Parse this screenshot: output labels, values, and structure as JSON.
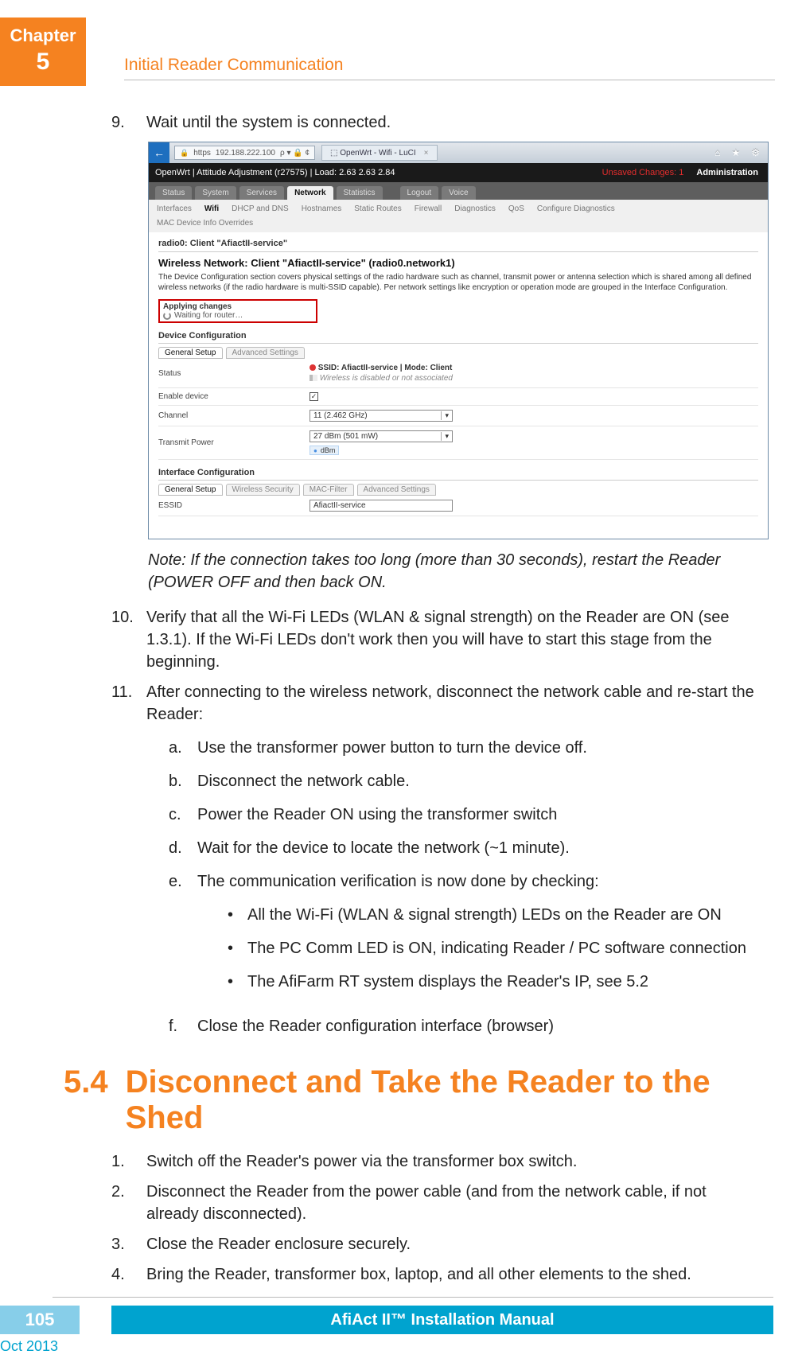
{
  "chapter": {
    "label": "Chapter",
    "number": "5"
  },
  "header_title": "Initial Reader Communication",
  "steps": {
    "s9": {
      "num": "9.",
      "text": "Wait until the system is connected."
    },
    "note": "Note: If the connection takes too long (more than 30 seconds), restart the Reader (POWER OFF and then back ON.",
    "s10": {
      "num": "10.",
      "text": "Verify that all the Wi-Fi LEDs (WLAN & signal strength) on the Reader are ON (see 1.3.1). If the Wi-Fi LEDs don't work then you will have to start this stage from the beginning."
    },
    "s11": {
      "num": "11.",
      "text": "After connecting to the wireless network, disconnect the network cable and re-start the Reader:",
      "sub": {
        "a": {
          "letter": "a.",
          "text": "Use the transformer power button to turn the device off."
        },
        "b": {
          "letter": "b.",
          "text": "Disconnect the network cable."
        },
        "c": {
          "letter": "c.",
          "text": "Power the Reader ON using the transformer switch"
        },
        "d": {
          "letter": "d.",
          "text": "Wait for the device to locate the network (~1 minute)."
        },
        "e": {
          "letter": "e.",
          "text": "The communication verification is now done by checking:",
          "bullets": {
            "b1": "All the Wi-Fi (WLAN & signal strength) LEDs on the Reader are ON",
            "b2": "The PC Comm LED is ON, indicating Reader / PC software connection",
            "b3": "The AfiFarm RT system displays the Reader's IP, see 5.2"
          }
        },
        "f": {
          "letter": "f.",
          "text": "Close the Reader configuration interface (browser)"
        }
      }
    }
  },
  "section54": {
    "num": "5.4",
    "title": "Disconnect and Take the Reader to the Shed",
    "items": {
      "i1": {
        "num": "1.",
        "text": "Switch off the Reader's power via the transformer box switch."
      },
      "i2": {
        "num": "2.",
        "text": "Disconnect the Reader from the power cable (and from the network cable, if not already disconnected)."
      },
      "i3": {
        "num": "3.",
        "text": "Close the Reader enclosure securely."
      },
      "i4": {
        "num": "4.",
        "text": "Bring the Reader, transformer box, laptop, and all other elements to the shed."
      }
    }
  },
  "screenshot": {
    "ie": {
      "url_prefix": "https",
      "url": "192.188.222.100",
      "url_suffix": "ρ ▾ 🔒 ¢",
      "tab": "OpenWrt - Wifi - LuCI",
      "close": "×",
      "home": "⌂",
      "star": "★",
      "gear": "⚙"
    },
    "luci": {
      "title": "OpenWrt | Attitude Adjustment (r27575) | Load: 2.63 2.63 2.84",
      "unsaved": "Unsaved Changes: 1",
      "admin": "Administration"
    },
    "tabs": {
      "status": "Status",
      "system": "System",
      "services": "Services",
      "network": "Network",
      "statistics": "Statistics",
      "logout": "Logout",
      "voice": "Voice"
    },
    "subtabs": {
      "interfaces": "Interfaces",
      "wifi": "Wifi",
      "dhcp": "DHCP and DNS",
      "hostnames": "Hostnames",
      "staticroutes": "Static Routes",
      "firewall": "Firewall",
      "diagnostics": "Diagnostics",
      "qos": "QoS",
      "configdiag": "Configure Diagnostics"
    },
    "macline": "MAC Device Info Overrides",
    "radio_header": "radio0: Client \"AfiactII-service\"",
    "net_header": "Wireless Network: Client \"AfiactII-service\" (radio0.network1)",
    "desc": "The Device Configuration section covers physical settings of the radio hardware such as channel, transmit power or antenna selection which is shared among all defined wireless networks (if the radio hardware is multi-SSID capable). Per network settings like encryption or operation mode are grouped in the Interface Configuration.",
    "applying": {
      "t1": "Applying changes",
      "t2": "Waiting for router…"
    },
    "devconf_hdr": "Device Configuration",
    "devconf_tabs": {
      "general": "General Setup",
      "adv": "Advanced Settings"
    },
    "row_status": {
      "k": "Status",
      "ssid_line": "SSID: AfiactII-service | Mode: Client",
      "disabled_line": "Wireless is disabled or not associated"
    },
    "row_enable": {
      "k": "Enable device",
      "checked": "✓"
    },
    "row_channel": {
      "k": "Channel",
      "v": "11 (2.462 GHz)"
    },
    "row_tx": {
      "k": "Transmit Power",
      "v": "27 dBm (501 mW)",
      "unit": "dBm"
    },
    "ifaceconf_hdr": "Interface Configuration",
    "iface_tabs": {
      "general": "General Setup",
      "ws": "Wireless Security",
      "mac": "MAC-Filter",
      "adv": "Advanced Settings"
    },
    "row_essid": {
      "k": "ESSID",
      "v": "AfiactII-service"
    }
  },
  "footer": {
    "page": "105",
    "title": "AfiAct II™ Installation Manual",
    "date": "Oct 2013"
  }
}
